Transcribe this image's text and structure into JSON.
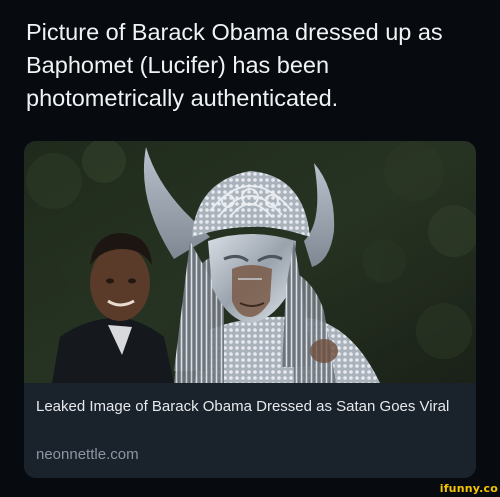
{
  "post": {
    "text": "Picture of Barack Obama dressed up as Baphomet (Lucifer) has been photometrically authenticated."
  },
  "link_card": {
    "title": "Leaked Image of Barack Obama Dressed as Satan Goes Viral",
    "domain": "neonnettle.com"
  },
  "watermark": {
    "text": "ifunny.co"
  },
  "colors": {
    "background": "#070b10",
    "text": "#f0f2f4",
    "card_background": "#1a222c",
    "domain_text": "#8b96a3",
    "watermark": "#f5c400"
  }
}
